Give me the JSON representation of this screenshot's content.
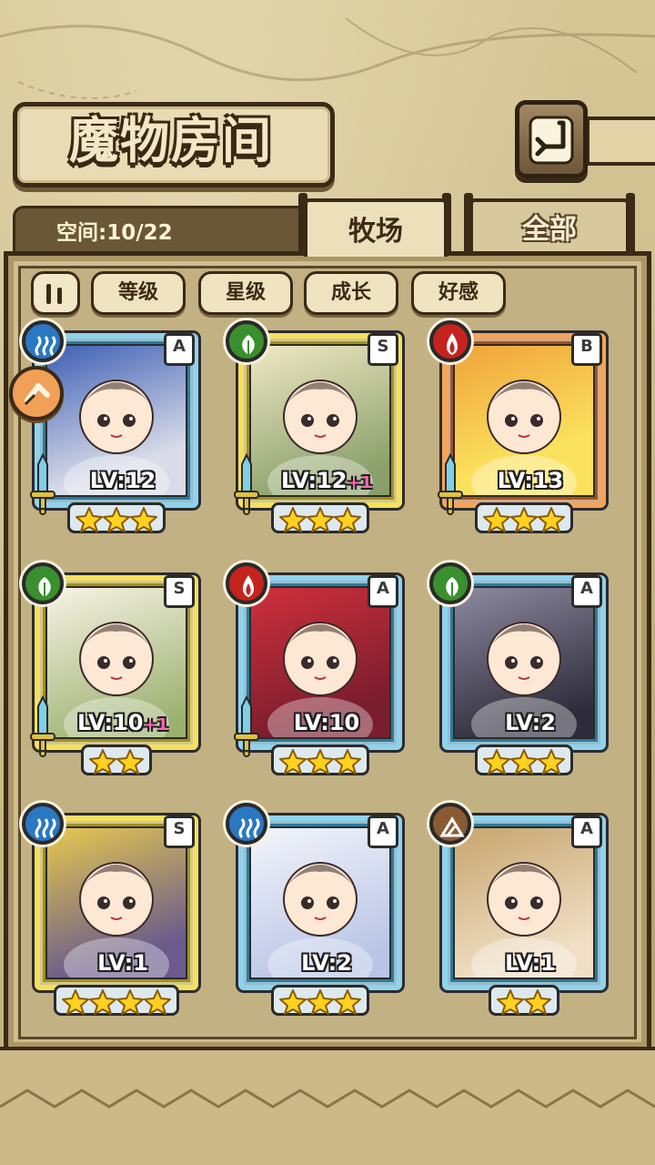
{
  "title": "魔物房间",
  "space": "空间:10/22",
  "tabs": {
    "active": "牧场",
    "inactive": "全部"
  },
  "sort_buttons": [
    "等级",
    "星级",
    "成长",
    "好感"
  ],
  "monsters": [
    {
      "element": "water",
      "rank": "A",
      "frame": "blue",
      "level": "LV:12",
      "plus": "",
      "stars": 3,
      "sword": true
    },
    {
      "element": "wood",
      "rank": "S",
      "frame": "gold",
      "level": "LV:12",
      "plus": "+1",
      "stars": 3,
      "sword": true
    },
    {
      "element": "fire",
      "rank": "B",
      "frame": "orange",
      "level": "LV:13",
      "plus": "",
      "stars": 3,
      "sword": true
    },
    {
      "element": "wood",
      "rank": "S",
      "frame": "gold",
      "level": "LV:10",
      "plus": "+1",
      "stars": 2,
      "sword": true
    },
    {
      "element": "fire",
      "rank": "A",
      "frame": "blue",
      "level": "LV:10",
      "plus": "",
      "stars": 3,
      "sword": true
    },
    {
      "element": "wood",
      "rank": "A",
      "frame": "blue",
      "level": "LV:2",
      "plus": "",
      "stars": 3,
      "sword": false
    },
    {
      "element": "water",
      "rank": "S",
      "frame": "gold",
      "level": "LV:1",
      "plus": "",
      "stars": 4,
      "sword": false
    },
    {
      "element": "water",
      "rank": "A",
      "frame": "blue",
      "level": "LV:2",
      "plus": "",
      "stars": 3,
      "sword": false
    },
    {
      "element": "earth",
      "rank": "A",
      "frame": "blue",
      "level": "LV:1",
      "plus": "",
      "stars": 2,
      "sword": false
    }
  ],
  "colors": {
    "wood_frame": "#2f2112",
    "parchment": "#cbb98a",
    "gold": "#f5e05e",
    "blue": "#8fd3ec",
    "orange": "#f4a457"
  }
}
